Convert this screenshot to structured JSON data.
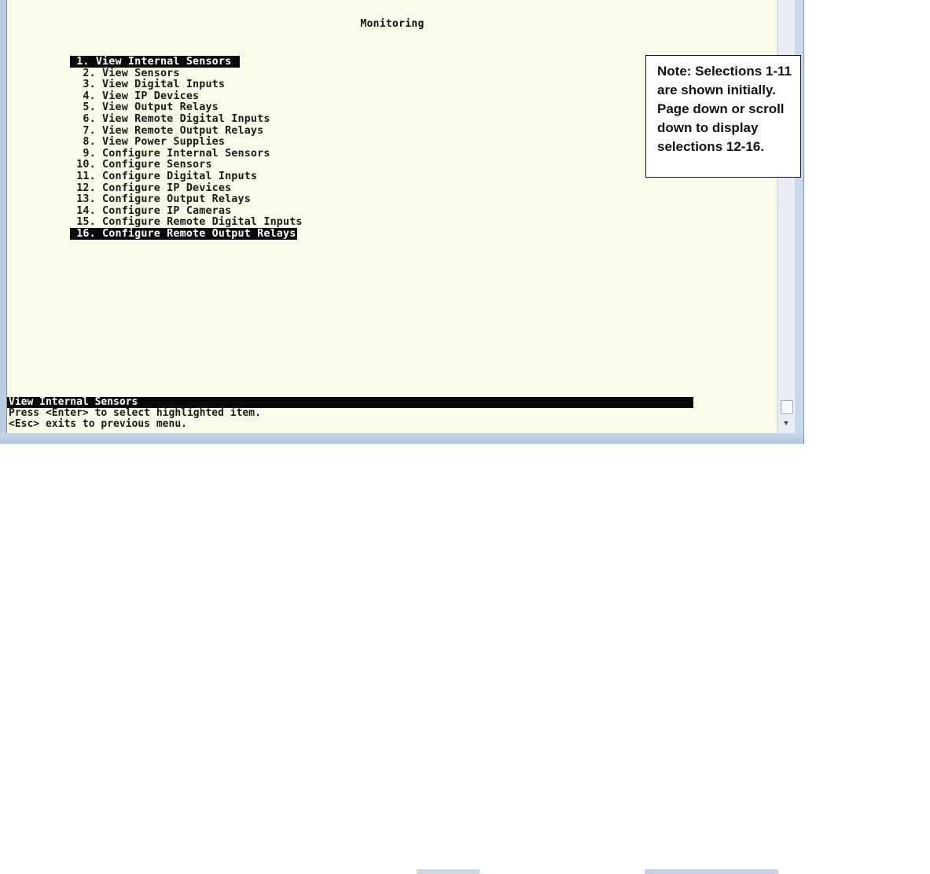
{
  "terminal": {
    "title": "Monitoring",
    "menu_items": [
      {
        "label": " 1. View Internal Sensors ",
        "selected": true
      },
      {
        "label": "  2. View Sensors"
      },
      {
        "label": "  3. View Digital Inputs"
      },
      {
        "label": "  4. View IP Devices"
      },
      {
        "label": "  5. View Output Relays"
      },
      {
        "label": "  6. View Remote Digital Inputs"
      },
      {
        "label": "  7. View Remote Output Relays"
      },
      {
        "label": "  8. View Power Supplies"
      },
      {
        "label": "  9. Configure Internal Sensors"
      },
      {
        "label": " 10. Configure Sensors"
      },
      {
        "label": " 11. Configure Digital Inputs"
      },
      {
        "label": " 12. Configure IP Devices"
      },
      {
        "label": " 13. Configure Output Relays"
      },
      {
        "label": " 14. Configure IP Cameras"
      },
      {
        "label": " 15. Configure Remote Digital Inputs"
      },
      {
        "label": " 16. Configure Remote Output Relays",
        "highlighted": true
      }
    ],
    "status": {
      "title": "View Internal Sensors",
      "help_line_1": "Press <Enter> to select highlighted item.",
      "help_line_2": "<Esc> exits to previous menu."
    }
  },
  "scrollbar": {
    "down_arrow_icon": "chevron-down-icon"
  },
  "note": {
    "text": "Note: Selections 1-11 are shown initially.   Page down or scroll down to display selections 12-16."
  }
}
